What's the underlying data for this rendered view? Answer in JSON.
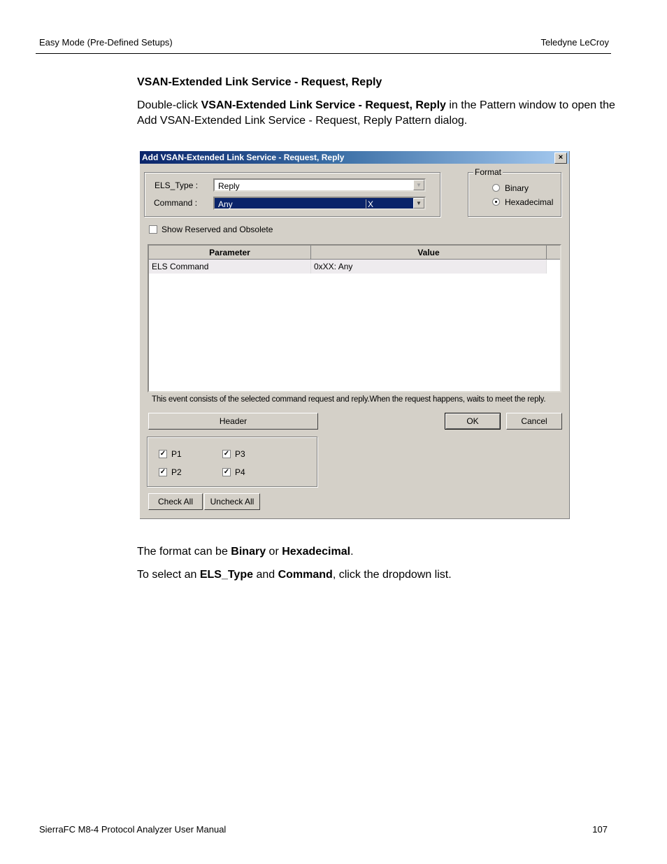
{
  "page_header": {
    "left": "Easy Mode (Pre-Defined Setups)",
    "right": "Teledyne  LeCroy"
  },
  "section_title": "VSAN-Extended Link Service - Request, Reply",
  "intro": {
    "pre": "Double-click ",
    "bold": "VSAN-Extended Link Service - Request, Reply",
    "post": " in the Pattern window to open the Add VSAN-Extended Link Service - Request, Reply Pattern dialog."
  },
  "dialog": {
    "title": "Add VSAN-Extended Link Service - Request, Reply",
    "close_label": "×",
    "els_type_label": "ELS_Type :",
    "els_type_value": "Reply",
    "command_label": "Command :",
    "command_value": "Any",
    "command_mask": "X",
    "format": {
      "legend": "Format",
      "options": [
        {
          "label": "Binary",
          "selected": false
        },
        {
          "label": "Hexadecimal",
          "selected": true
        }
      ]
    },
    "show_reserved": {
      "label": "Show Reserved and Obsolete",
      "checked": false
    },
    "table": {
      "columns": [
        "Parameter",
        "Value"
      ],
      "rows": [
        {
          "parameter": "ELS Command",
          "value": "0xXX: Any"
        }
      ]
    },
    "description": "This event consists of the selected command request and reply.When the request happens, waits to meet the reply.",
    "header_button": "Header",
    "ok_button": "OK",
    "cancel_button": "Cancel",
    "ports": [
      {
        "label": "P1",
        "checked": true
      },
      {
        "label": "P2",
        "checked": true
      },
      {
        "label": "P3",
        "checked": true
      },
      {
        "label": "P4",
        "checked": true
      }
    ],
    "check_all": "Check All",
    "uncheck_all": "Uncheck All"
  },
  "notes": {
    "format_line": {
      "pre": "The format can be ",
      "b1": "Binary",
      "mid": " or ",
      "b2": "Hexadecimal",
      "post": "."
    },
    "select_line": {
      "pre": "To select an ",
      "b1": "ELS_Type",
      "mid": " and ",
      "b2": "Command",
      "post": ", click the dropdown list."
    }
  },
  "page_footer": {
    "left": "SierraFC M8-4 Protocol Analyzer User Manual",
    "page_number": "107"
  }
}
